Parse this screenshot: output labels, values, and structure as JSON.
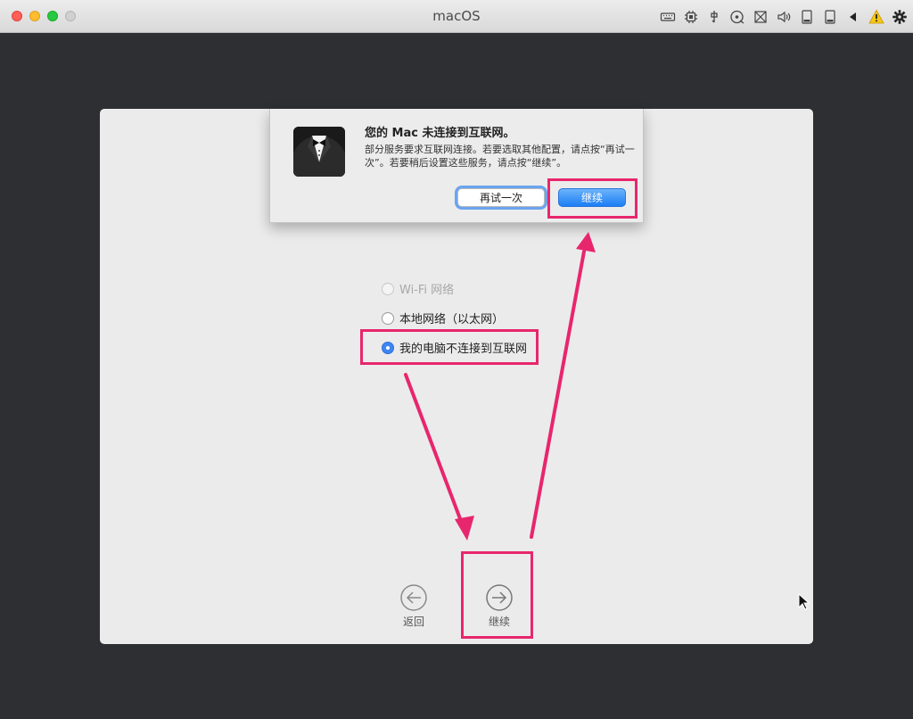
{
  "window": {
    "title": "macOS",
    "tray_icons": [
      "keyboard-icon",
      "cpu-icon",
      "usb-icon",
      "disc-icon",
      "network-disabled-icon",
      "speaker-icon",
      "hard-disk-icon",
      "hard-disk-icon",
      "play-back-icon",
      "warning-icon",
      "gear-icon"
    ]
  },
  "alert": {
    "icon": "butler-tuxedo-icon",
    "title": "您的 Mac 未连接到互联网。",
    "message": "部分服务要求互联网连接。若要选取其他配置，请点按“再试一次”。若要稍后设置这些服务，请点按“继续”。",
    "retry_label": "再试一次",
    "continue_label": "继续"
  },
  "network_options": [
    {
      "label": "Wi-Fi 网络",
      "selected": false,
      "disabled": true
    },
    {
      "label": "本地网络（以太网）",
      "selected": false,
      "disabled": false
    },
    {
      "label": "我的电脑不连接到互联网",
      "selected": true,
      "disabled": false
    }
  ],
  "navigation": {
    "back_label": "返回",
    "continue_label": "继续"
  },
  "colors": {
    "highlight": "#e8266d",
    "accent": "#3f85f4",
    "background": "#2e2f33"
  }
}
